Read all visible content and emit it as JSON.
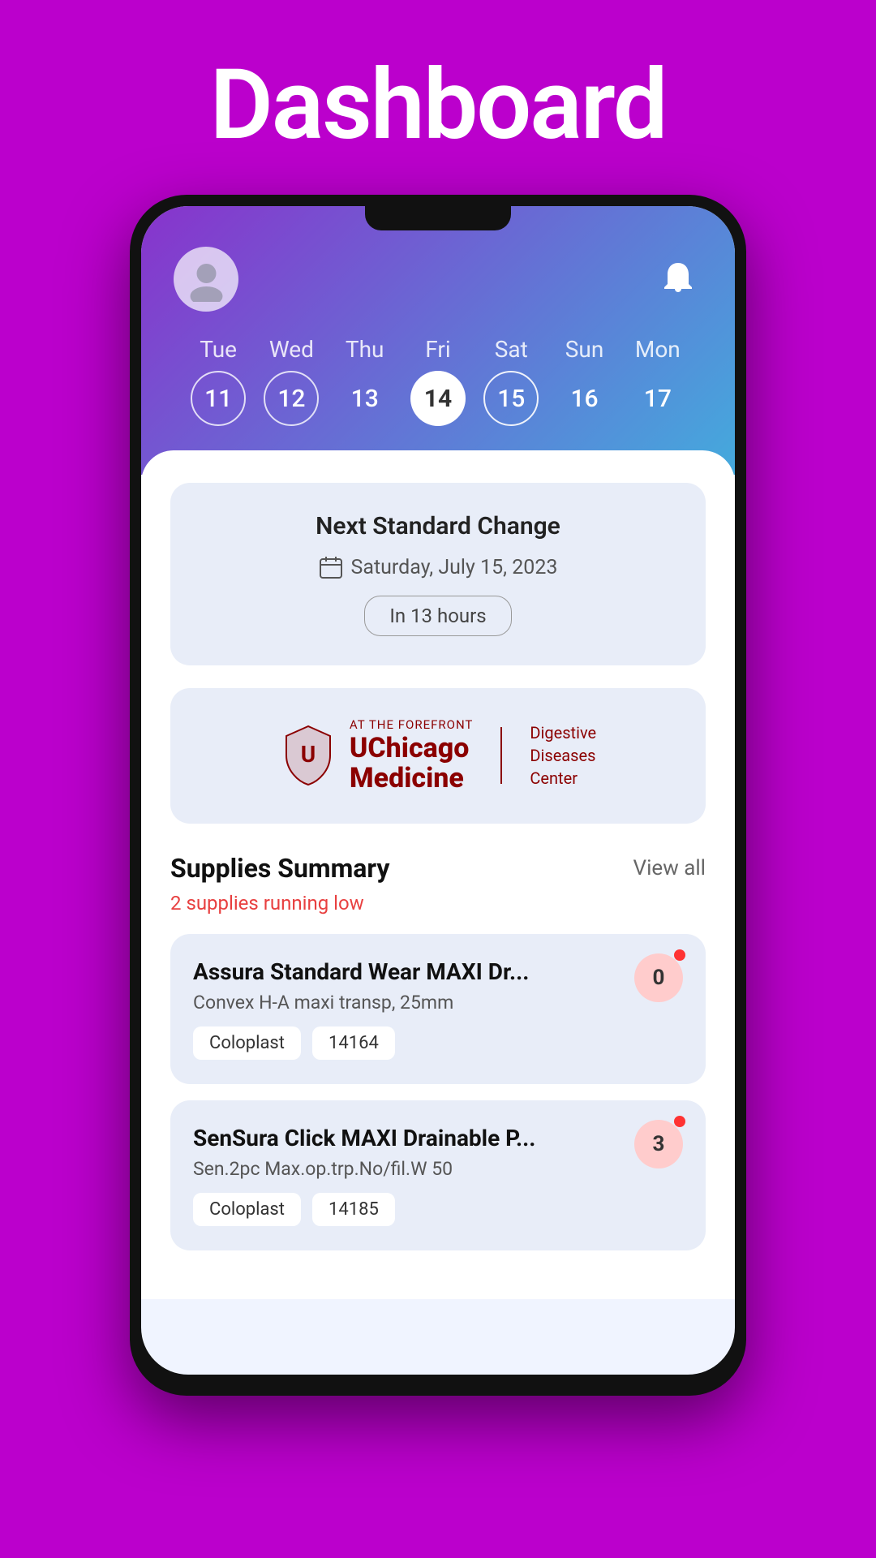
{
  "page": {
    "title": "Dashboard"
  },
  "header": {
    "notification_icon": "bell-icon"
  },
  "calendar": {
    "days": [
      {
        "label": "Tue",
        "number": "11",
        "state": "ring"
      },
      {
        "label": "Wed",
        "number": "12",
        "state": "ring"
      },
      {
        "label": "Thu",
        "number": "13",
        "state": "plain"
      },
      {
        "label": "Fri",
        "number": "14",
        "state": "selected"
      },
      {
        "label": "Sat",
        "number": "15",
        "state": "selected-ring"
      },
      {
        "label": "Sun",
        "number": "16",
        "state": "plain"
      },
      {
        "label": "Mon",
        "number": "17",
        "state": "plain"
      }
    ]
  },
  "next_change": {
    "title": "Next Standard Change",
    "date": "Saturday, July 15, 2023",
    "time_label": "In 13 hours"
  },
  "hospital": {
    "name_prefix": "AT THE FOREFRONT",
    "name_main": "UChicago\nMedicine",
    "division": "Digestive\nDiseases\nCenter"
  },
  "supplies": {
    "section_title": "Supplies Summary",
    "view_all_label": "View all",
    "warning_text": "2 supplies running low",
    "items": [
      {
        "title": "Assura Standard Wear MAXI Dr...",
        "subtitle": "Convex H-A maxi transp, 25mm",
        "brand": "Coloplast",
        "code": "14164",
        "count": "0",
        "has_dot": true
      },
      {
        "title": "SenSura Click MAXI Drainable P...",
        "subtitle": "Sen.2pc Max.op.trp.No/fil.W 50",
        "brand": "Coloplast",
        "code": "14185",
        "count": "3",
        "has_dot": true
      }
    ]
  }
}
